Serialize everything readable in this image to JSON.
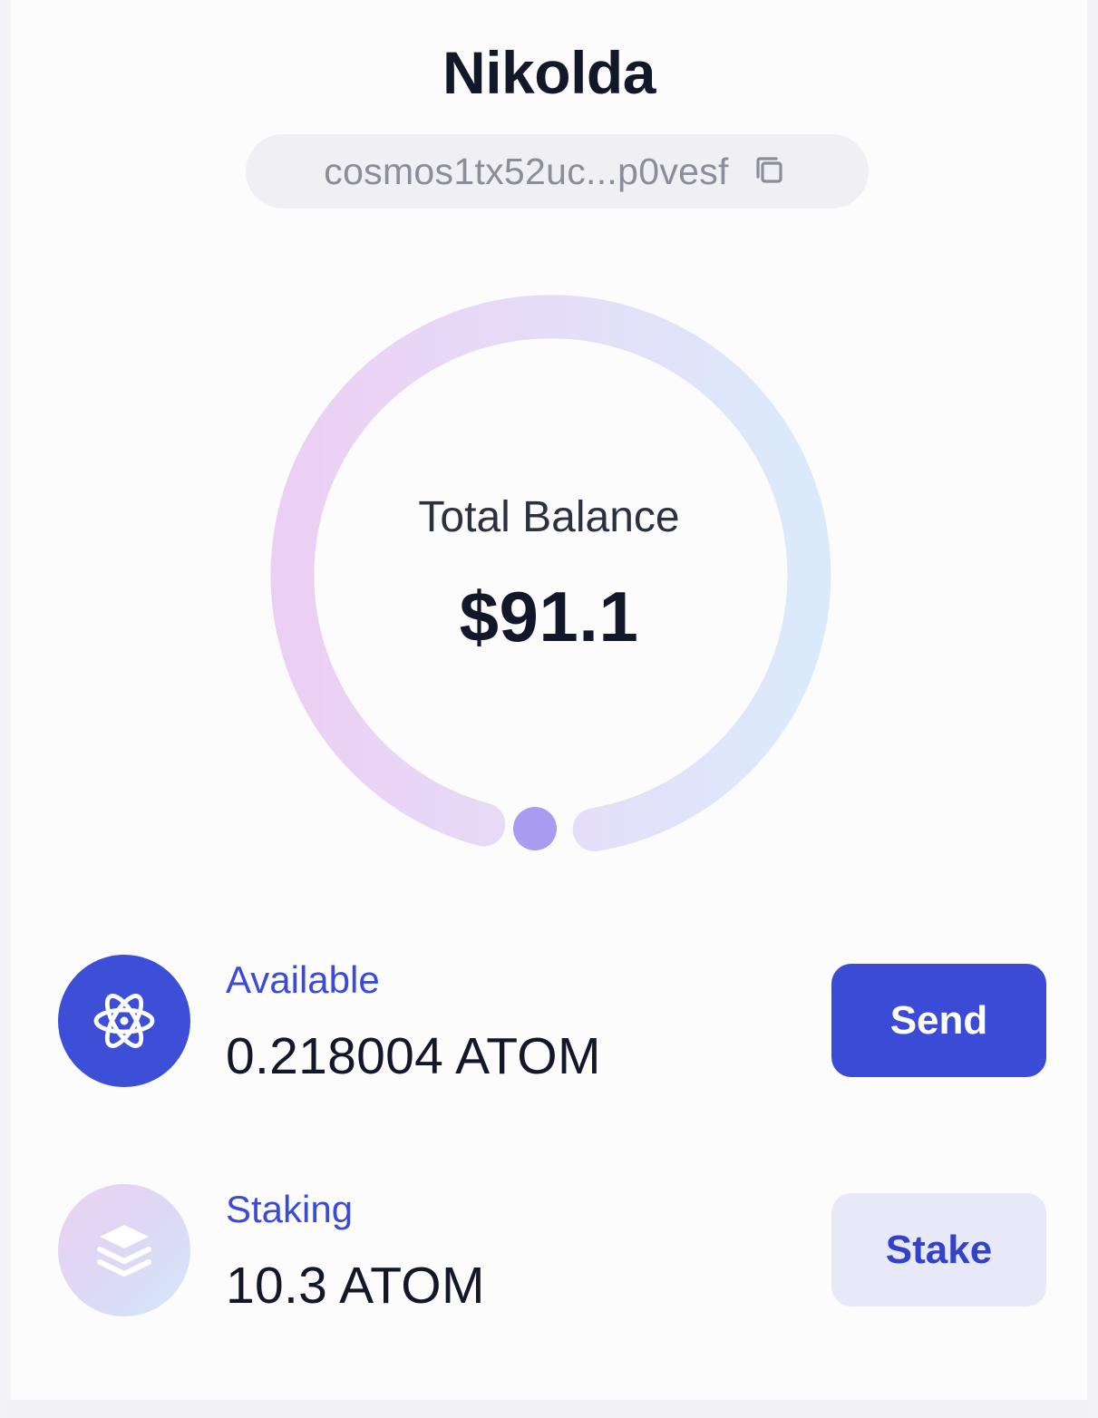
{
  "account": {
    "name": "Nikolda",
    "address": "cosmos1tx52uc...p0vesf"
  },
  "balance": {
    "label": "Total Balance",
    "value": "$91.1"
  },
  "assets": {
    "available": {
      "label": "Available",
      "amount": "0.218004 ATOM",
      "button_label": "Send",
      "icon": "atom-icon"
    },
    "staking": {
      "label": "Staking",
      "amount": "10.3 ATOM",
      "button_label": "Stake",
      "icon": "stack-icon"
    }
  },
  "icons": {
    "copy": "copy-icon",
    "ring": "balance-ring"
  },
  "colors": {
    "accent": "#3b4bd5",
    "secondary_button": "#e7e9f8",
    "ring_start": "#eccff4",
    "ring_end": "#dbeafb",
    "ring_dot": "#a99bf2"
  }
}
